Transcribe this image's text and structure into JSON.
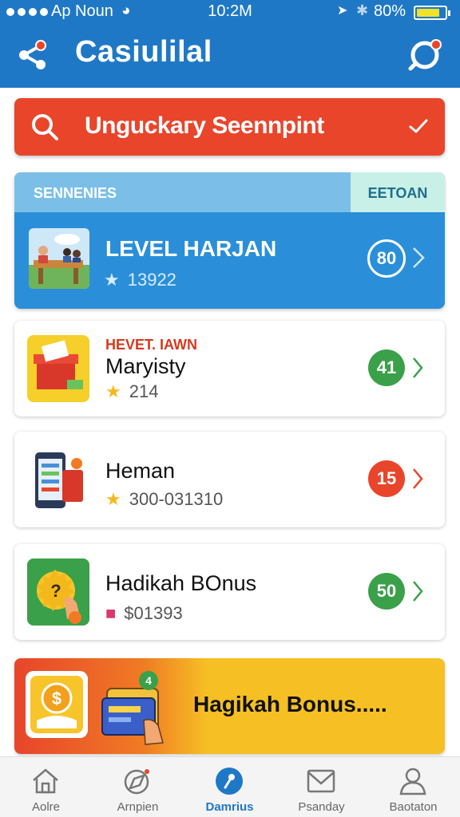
{
  "status_bar": {
    "carrier": "Ap Noun",
    "time": "10:2M",
    "battery": "80%"
  },
  "header": {
    "title": "Casiulilal"
  },
  "banner": {
    "text": "Unguckaгy Seennpint"
  },
  "featured": {
    "section_label": "SENNENIES",
    "tab_label": "EETOAN",
    "title": "LEVEL HARJAN",
    "meta": "13922",
    "badge": "80"
  },
  "cards": [
    {
      "kicker": "HEVET. IAWN",
      "title": "Maryisty",
      "meta": "214",
      "badge": "41",
      "badge_color": "#3aa04a"
    },
    {
      "kicker": "",
      "title": "Heman",
      "meta": "300-031310",
      "badge": "15",
      "badge_color": "#e8452b"
    },
    {
      "kicker": "",
      "title": "Hadikah BOnus",
      "meta": "$01393",
      "badge": "50",
      "badge_color": "#3aa04a"
    }
  ],
  "promo": {
    "text": "Hagikah Bonus....."
  },
  "bottom_nav": [
    {
      "label": "Aolre",
      "icon": "home-icon",
      "active": false
    },
    {
      "label": "Arnpien",
      "icon": "compass-icon",
      "active": false
    },
    {
      "label": "Damrius",
      "icon": "pin-icon",
      "active": true
    },
    {
      "label": "Psanday",
      "icon": "mail-icon",
      "active": false
    },
    {
      "label": "Baotaton",
      "icon": "profile-icon",
      "active": false
    }
  ],
  "colors": {
    "header": "#1f78c6",
    "banner": "#e8452b",
    "featured": "#2a8fd8",
    "badge_green": "#3aa04a",
    "badge_red": "#e8452b",
    "promo_yellow": "#f6c024"
  }
}
